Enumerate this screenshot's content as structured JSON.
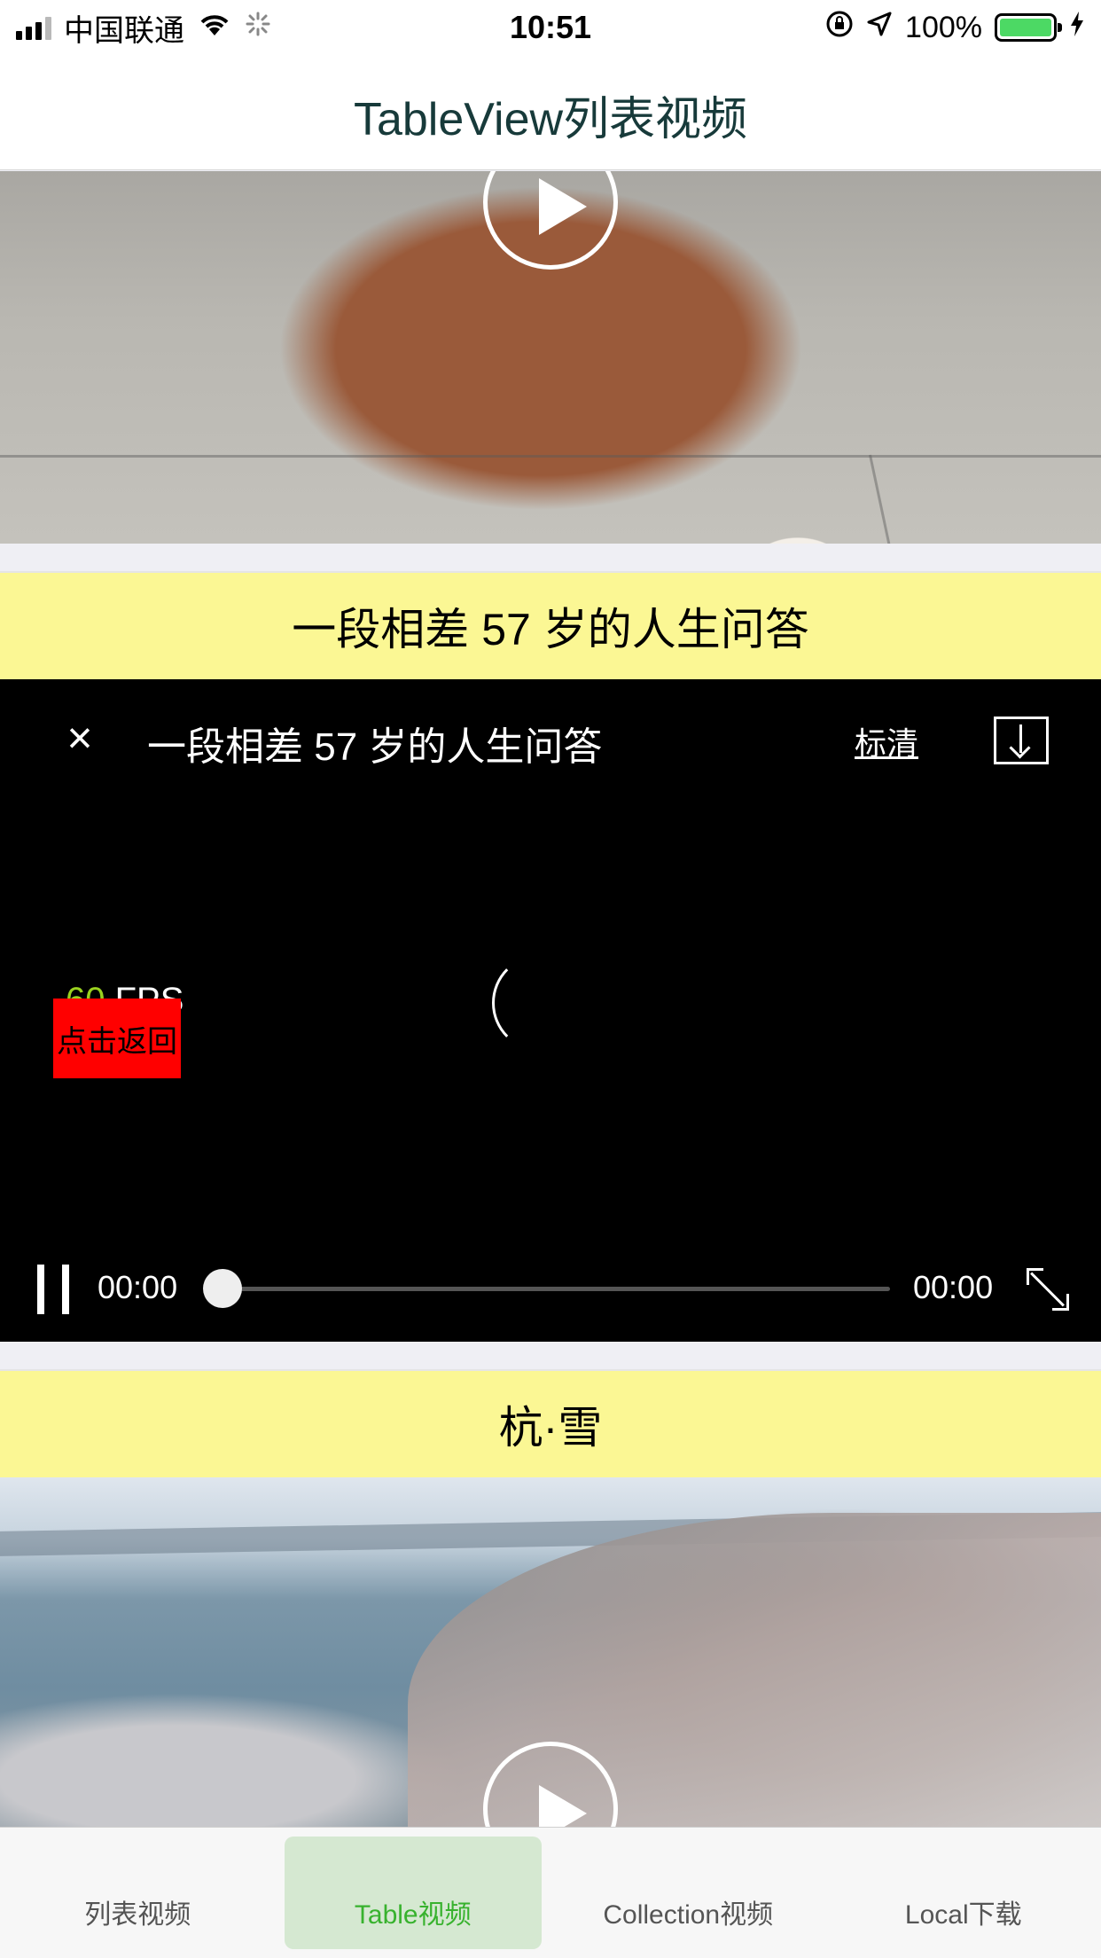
{
  "status_bar": {
    "carrier": "中国联通",
    "time": "10:51",
    "battery": "100%",
    "battery_level": 1.0
  },
  "nav": {
    "title": "TableView列表视频"
  },
  "cells": [
    {
      "title": "",
      "image": "dog-lying-on-pavement",
      "has_play_button": true
    },
    {
      "title": "一段相差 57 岁的人生问答",
      "playing": true
    },
    {
      "title": "杭·雪",
      "image": "snowy-lakeside-aerial",
      "has_play_button": true
    }
  ],
  "player": {
    "title": "一段相差 57 岁的人生问答",
    "quality": "标清",
    "fps_value": "60",
    "fps_unit": "FPS",
    "back_label": "点击返回",
    "current_time": "00:00",
    "total_time": "00:00",
    "progress": 0
  },
  "tabs": [
    {
      "label": "列表视频",
      "active": false
    },
    {
      "label": "Table视频",
      "active": true
    },
    {
      "label": "Collection视频",
      "active": false
    },
    {
      "label": "Local下载",
      "active": false
    }
  ],
  "colors": {
    "title_bg": "#fbf794",
    "tab_active_text": "#38b22e",
    "tab_active_bg": "#d5e8d1",
    "back_button_bg": "#ff0000",
    "fps_value": "#9ad11f",
    "battery_fill": "#4cd964"
  }
}
